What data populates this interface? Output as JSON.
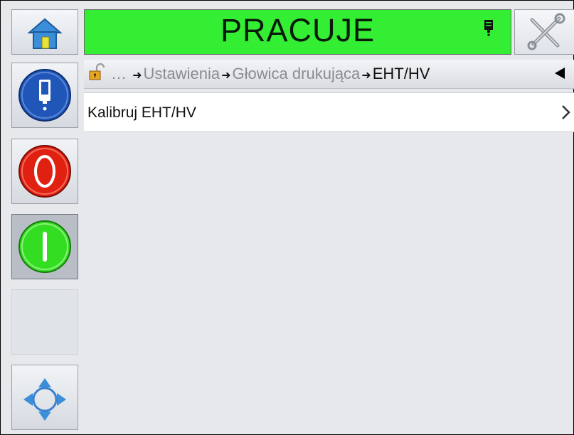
{
  "header": {
    "status_text": "PRACUJE",
    "status_color": "#33ee33",
    "status_icon": "printhead-icon",
    "home_icon": "home-icon",
    "tools_icon": "tools-icon"
  },
  "sidebar": {
    "buttons": [
      {
        "name": "ink-system-button",
        "icon": "ink-drop-icon"
      },
      {
        "name": "stop-button",
        "icon": "power-off-icon",
        "color": "#e02010"
      },
      {
        "name": "start-button",
        "icon": "power-on-icon",
        "color": "#33dd22",
        "pressed": true
      },
      {
        "name": "empty-slot",
        "icon": ""
      },
      {
        "name": "navigation-button",
        "icon": "navigation-arrows-icon"
      }
    ]
  },
  "breadcrumb": {
    "ellipsis": "…",
    "items": [
      "Ustawienia",
      "Głowica drukująca"
    ],
    "current": "EHT/HV",
    "lock_icon": "unlocked-padlock-icon",
    "back_icon": "back-arrow-icon"
  },
  "menu": {
    "items": [
      {
        "label": "Kalibruj EHT/HV",
        "icon": "chevron-right-icon"
      }
    ]
  }
}
